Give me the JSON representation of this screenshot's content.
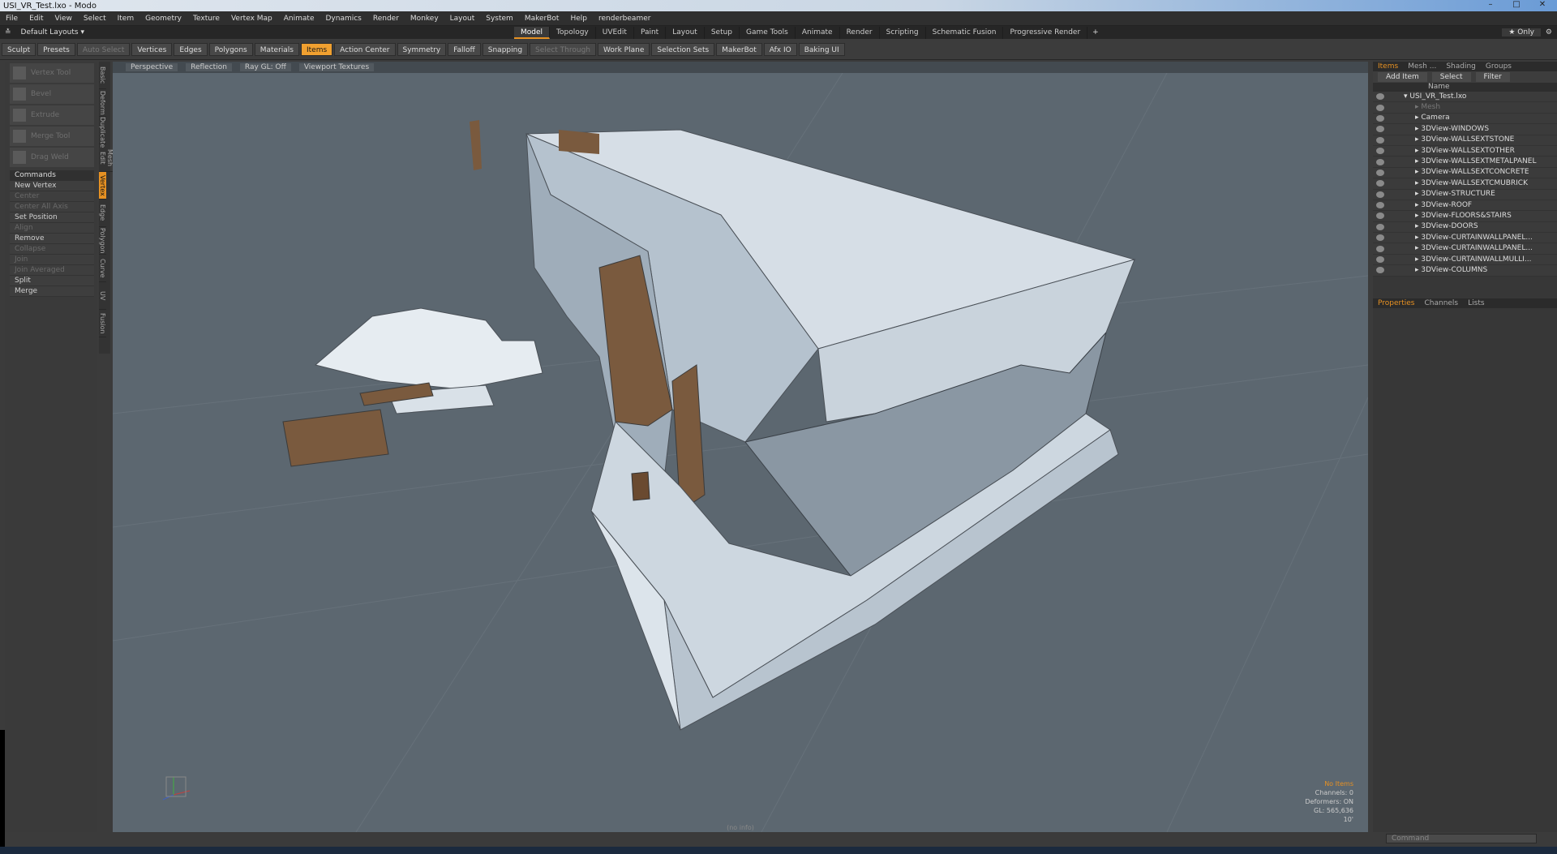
{
  "window": {
    "title": "USI_VR_Test.lxo - Modo"
  },
  "menu": [
    "File",
    "Edit",
    "View",
    "Select",
    "Item",
    "Geometry",
    "Texture",
    "Vertex Map",
    "Animate",
    "Dynamics",
    "Render",
    "Monkey",
    "Layout",
    "System",
    "MakerBot",
    "Help",
    "renderbeamer"
  ],
  "layouts": {
    "current": "Default Layouts",
    "tabs": [
      "Model",
      "Topology",
      "UVEdit",
      "Paint",
      "Layout",
      "Setup",
      "Game Tools",
      "Animate",
      "Render",
      "Scripting",
      "Schematic Fusion",
      "Progressive Render"
    ],
    "active": "Model",
    "only_label": "Only"
  },
  "toolbar": {
    "items": [
      {
        "label": "Sculpt",
        "state": "normal"
      },
      {
        "label": "Presets",
        "state": "normal"
      },
      {
        "label": "Auto Select",
        "state": "disabled"
      },
      {
        "label": "Vertices",
        "state": "normal"
      },
      {
        "label": "Edges",
        "state": "normal"
      },
      {
        "label": "Polygons",
        "state": "normal"
      },
      {
        "label": "Materials",
        "state": "normal"
      },
      {
        "label": "Items",
        "state": "active"
      },
      {
        "label": "Action Center",
        "state": "normal"
      },
      {
        "label": "Symmetry",
        "state": "normal"
      },
      {
        "label": "Falloff",
        "state": "normal"
      },
      {
        "label": "Snapping",
        "state": "normal"
      },
      {
        "label": "Select Through",
        "state": "disabled"
      },
      {
        "label": "Work Plane",
        "state": "normal"
      },
      {
        "label": "Selection Sets",
        "state": "normal"
      },
      {
        "label": "MakerBot",
        "state": "normal"
      },
      {
        "label": "Afx IO",
        "state": "normal"
      },
      {
        "label": "Baking UI",
        "state": "normal"
      }
    ]
  },
  "left_panel": {
    "tools": [
      "Vertex Tool",
      "Bevel",
      "Extrude",
      "Merge Tool",
      "Drag Weld"
    ],
    "commands_header": "Commands",
    "commands": [
      {
        "label": "New Vertex",
        "enabled": true
      },
      {
        "label": "Center",
        "enabled": false
      },
      {
        "label": "Center All Axis",
        "enabled": false
      },
      {
        "label": "Set Position",
        "enabled": true
      },
      {
        "label": "Align",
        "enabled": false
      },
      {
        "label": "Remove",
        "enabled": true
      },
      {
        "label": "Collapse",
        "enabled": false
      },
      {
        "label": "Join",
        "enabled": false
      },
      {
        "label": "Join Averaged",
        "enabled": false
      },
      {
        "label": "Split",
        "enabled": true
      },
      {
        "label": "Merge",
        "enabled": true
      }
    ],
    "vertical_tabs": [
      "Basic",
      "Deform",
      "Duplicate",
      "Mesh Edit",
      "Vertex",
      "Edge",
      "Polygon",
      "Curve",
      "UV",
      "Fusion"
    ],
    "active_vertical_tab": "Vertex"
  },
  "viewport": {
    "header": [
      "Perspective",
      "Reflection",
      "Ray GL: Off",
      "Viewport Textures"
    ],
    "status": {
      "selection": "No Items",
      "channels": "Channels: 0",
      "deformers": "Deformers: ON",
      "gl": "GL: 565,636",
      "scale": "10'"
    },
    "info": "(no info)"
  },
  "right_panel": {
    "tabs": [
      "Items",
      "Mesh ...",
      "Shading",
      "Groups"
    ],
    "active_tab": "Items",
    "buttons": [
      "Add Item",
      "Select",
      "Filter"
    ],
    "column_name": "Name",
    "tree": [
      {
        "label": "USI_VR_Test.lxo",
        "indent": 0,
        "enabled": true
      },
      {
        "label": "Mesh",
        "indent": 1,
        "enabled": false
      },
      {
        "label": "Camera",
        "indent": 1,
        "enabled": true
      },
      {
        "label": "3DView-WINDOWS",
        "indent": 1,
        "enabled": true
      },
      {
        "label": "3DView-WALLSEXTSTONE",
        "indent": 1,
        "enabled": true
      },
      {
        "label": "3DView-WALLSEXTOTHER",
        "indent": 1,
        "enabled": true
      },
      {
        "label": "3DView-WALLSEXTMETALPANEL",
        "indent": 1,
        "enabled": true
      },
      {
        "label": "3DView-WALLSEXTCONCRETE",
        "indent": 1,
        "enabled": true
      },
      {
        "label": "3DView-WALLSEXTCMUBRICK",
        "indent": 1,
        "enabled": true
      },
      {
        "label": "3DView-STRUCTURE",
        "indent": 1,
        "enabled": true
      },
      {
        "label": "3DView-ROOF",
        "indent": 1,
        "enabled": true
      },
      {
        "label": "3DView-FLOORS&STAIRS",
        "indent": 1,
        "enabled": true
      },
      {
        "label": "3DView-DOORS",
        "indent": 1,
        "enabled": true
      },
      {
        "label": "3DView-CURTAINWALLPANEL...",
        "indent": 1,
        "enabled": true
      },
      {
        "label": "3DView-CURTAINWALLPANEL...",
        "indent": 1,
        "enabled": true
      },
      {
        "label": "3DView-CURTAINWALLMULLI...",
        "indent": 1,
        "enabled": true
      },
      {
        "label": "3DView-COLUMNS",
        "indent": 1,
        "enabled": true
      }
    ],
    "lower_tabs": [
      "Properties",
      "Channels",
      "Lists"
    ],
    "lower_active": "Properties"
  },
  "command_line": {
    "placeholder": "Command"
  },
  "colors": {
    "accent": "#e69123",
    "viewport_bg": "#5c6770",
    "model_light": "#c9d6e4",
    "model_wood": "#7a5a3e"
  }
}
